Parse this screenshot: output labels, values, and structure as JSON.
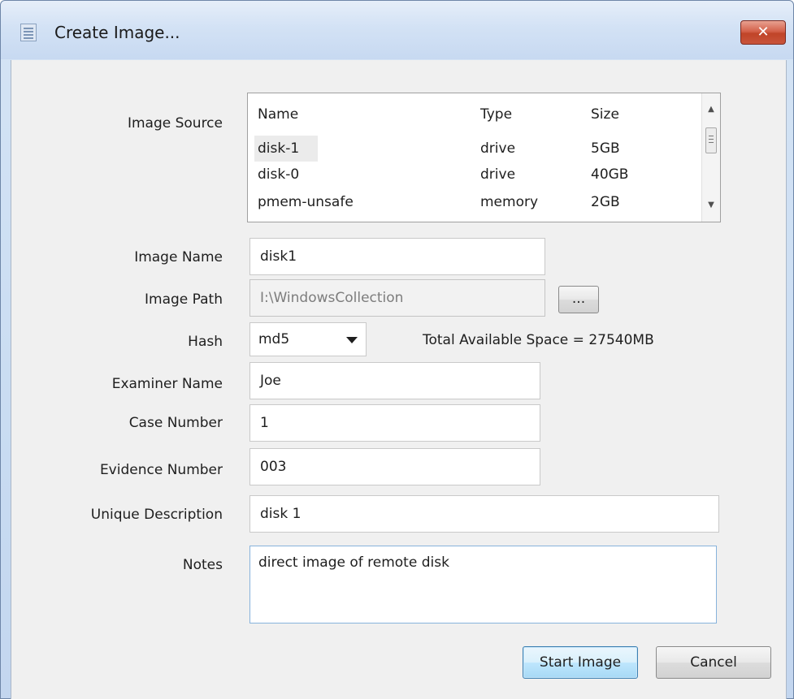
{
  "window": {
    "title": "Create Image...",
    "close_label": "✕"
  },
  "image_source": {
    "label": "Image Source",
    "columns": [
      "Name",
      "Type",
      "Size"
    ],
    "rows": [
      {
        "name": "disk-1",
        "type": "drive",
        "size": "5GB"
      },
      {
        "name": "disk-0",
        "type": "drive",
        "size": "40GB"
      },
      {
        "name": "pmem-unsafe",
        "type": "memory",
        "size": "2GB"
      }
    ]
  },
  "image_name": {
    "label": "Image Name",
    "value": "disk1"
  },
  "image_path": {
    "label": "Image Path",
    "value": "I:\\WindowsCollection",
    "browse_label": "..."
  },
  "hash": {
    "label": "Hash",
    "selected": "md5"
  },
  "space": {
    "text": "Total Available Space = 27540MB"
  },
  "examiner_name": {
    "label": "Examiner Name",
    "value": "Joe"
  },
  "case_number": {
    "label": "Case Number",
    "value": "1"
  },
  "evidence_number": {
    "label": "Evidence Number",
    "value": "003"
  },
  "unique_description": {
    "label": "Unique Description",
    "value": "disk 1"
  },
  "notes": {
    "label": "Notes",
    "value": "direct image of remote disk"
  },
  "buttons": {
    "start": "Start Image",
    "cancel": "Cancel"
  }
}
